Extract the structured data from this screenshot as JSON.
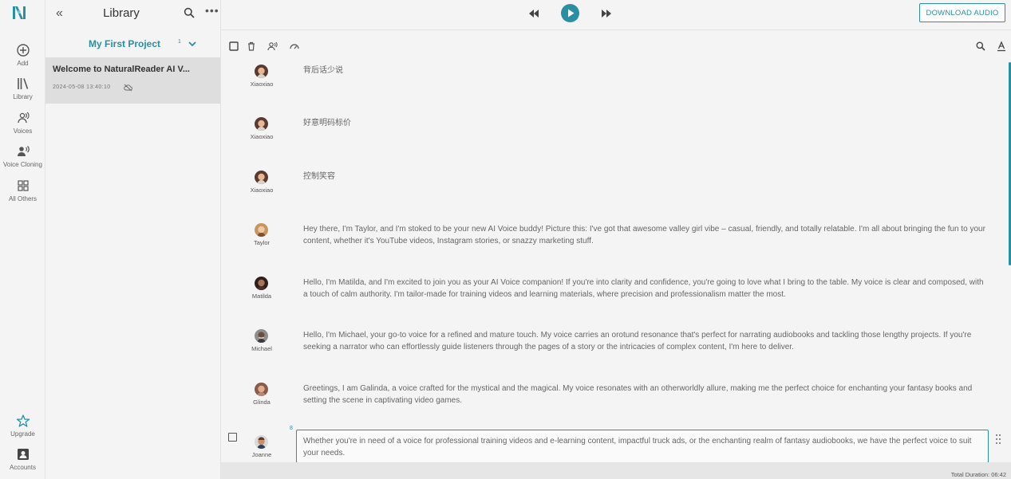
{
  "app": {
    "brand_color": "#2a8fa3"
  },
  "rail": {
    "items": [
      {
        "label": "Add",
        "icon": "plus-circle-icon"
      },
      {
        "label": "Library",
        "icon": "library-icon"
      },
      {
        "label": "Voices",
        "icon": "voices-icon"
      },
      {
        "label": "Voice Cloning",
        "icon": "voice-cloning-icon"
      },
      {
        "label": "All Others",
        "icon": "grid-icon"
      },
      {
        "label": "Upgrade",
        "icon": "star-icon"
      },
      {
        "label": "Accounts",
        "icon": "account-icon"
      }
    ]
  },
  "library": {
    "title": "Library",
    "project": {
      "name": "My First Project",
      "count": "1"
    },
    "documents": [
      {
        "title": "Welcome to NaturalReader AI V...",
        "date": "2024-05-08 13:40:10"
      }
    ]
  },
  "topbar": {
    "download_label": "DOWNLOAD AUDIO"
  },
  "rows": [
    {
      "voice": "Xiaoxiao",
      "text": "背后话少说"
    },
    {
      "voice": "Xiaoxiao",
      "text": "好意明码标价"
    },
    {
      "voice": "Xiaoxiao",
      "text": "控制笑容"
    },
    {
      "voice": "Taylor",
      "text": "Hey there, I'm Taylor, and I'm stoked to be your new AI Voice buddy! Picture this: I've got that awesome valley girl vibe – casual, friendly, and totally relatable. I'm all about bringing the fun to your content, whether it's YouTube videos, Instagram stories, or snazzy marketing stuff."
    },
    {
      "voice": "Matilda",
      "text": "Hello, I'm Matilda, and I'm excited to join you as your AI Voice companion! If you're into clarity and confidence, you're going to love what I bring to the table. My voice is clear and composed, with a touch of calm authority. I'm tailor-made for training videos and learning materials, where precision and professionalism matter the most."
    },
    {
      "voice": "Michael",
      "text": "Hello, I'm Michael, your go-to voice for a refined and mature touch. My voice carries an orotund resonance that's perfect for narrating audiobooks and tackling those lengthy projects. If you're seeking a narrator who can effortlessly guide listeners through the pages of a story or the intricacies of complex content, I'm here to deliver."
    },
    {
      "voice": "Glinda",
      "text": "Greetings, I am Galinda, a voice crafted for the mystical and the magical. My voice resonates with an otherworldly allure, making me the perfect choice for enchanting your fantasy books and setting the scene in captivating video games."
    },
    {
      "voice": "Joanne",
      "index": "8",
      "text": "Whether you're in need of a voice for professional training videos and e-learning content, impactful truck ads, or the enchanting realm of fantasy audiobooks, we have the perfect voice to suit your needs."
    }
  ],
  "footer": {
    "total_duration": "Total Duration: 06:42"
  }
}
